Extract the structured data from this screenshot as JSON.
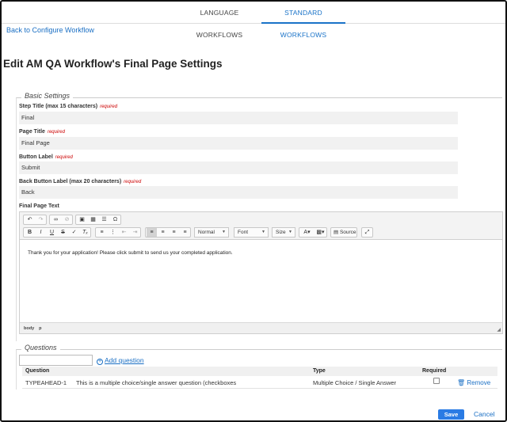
{
  "tabs": [
    "LANGUAGE WORKFLOWS",
    "STANDARD WORKFLOWS"
  ],
  "active_tab": "STANDARD WORKFLOWS",
  "back_link": "Back to Configure Workflow",
  "page_title": "Edit AM QA Workflow's Final Page Settings",
  "basic_settings": {
    "legend": "Basic Settings",
    "required_text": "required",
    "fields": [
      {
        "label": "Step Title (max 15 characters)",
        "value": "Final"
      },
      {
        "label": "Page Title",
        "value": "Final Page"
      },
      {
        "label": "Button Label",
        "value": "Submit"
      },
      {
        "label": "Back Button Label (max 20 characters)",
        "value": "Back"
      }
    ],
    "final_page_text_label": "Final Page Text"
  },
  "editor": {
    "toolbar_icons": [
      "undo-icon",
      "redo-icon",
      "link-icon",
      "unlink-icon",
      "image-icon",
      "table-icon",
      "horizontal-line-icon",
      "special-char-icon",
      "bold-icon",
      "italic-icon",
      "underline-icon",
      "strikethrough-icon",
      "format-painter-icon",
      "remove-format-icon",
      "numbered-list-icon",
      "bulleted-list-icon",
      "outdent-icon",
      "indent-icon",
      "align-left-icon",
      "align-center-icon",
      "align-right-icon",
      "justify-icon",
      "text-color-icon",
      "background-color-icon",
      "source-icon",
      "maximize-icon"
    ],
    "format": "Normal",
    "font": "Font",
    "size": "Size",
    "source_label": "Source",
    "content": "Thank you for your application! Please click submit to send us your completed application.",
    "path": [
      "body",
      "p"
    ]
  },
  "questions": {
    "legend": "Questions",
    "search_value": "",
    "add_label": "Add question",
    "headers": {
      "question": "Question",
      "type": "Type",
      "required": "Required"
    },
    "rows": [
      {
        "id": "TYPEAHEAD-1",
        "text": "This is a multiple choice/single answer question (checkboxes",
        "type": "Multiple Choice / Single Answer",
        "required": false,
        "action": "Remove"
      }
    ]
  },
  "footer": {
    "save": "Save",
    "cancel": "Cancel"
  },
  "colors": {
    "accent": "#1a73c8",
    "required": "#cc0000",
    "save_button": "#2a7be4"
  }
}
